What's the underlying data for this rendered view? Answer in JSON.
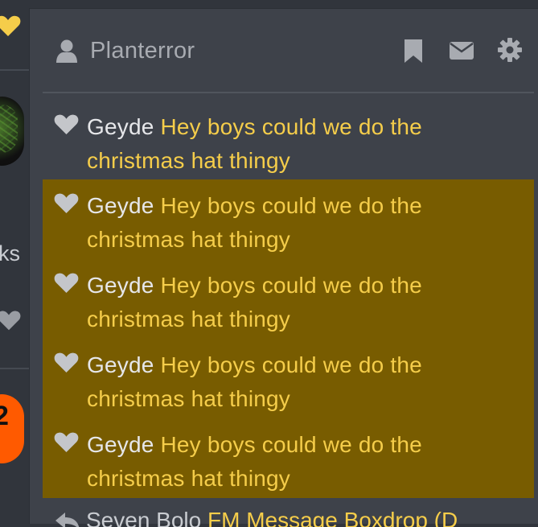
{
  "colors": {
    "accent_yellow": "#f5cd4a",
    "highlight_bg": "#785c00",
    "panel_bg": "#3e424a",
    "page_bg": "#31353c",
    "icon_gray": "#a8abb1",
    "left_heart": "#f5cd4a",
    "orange_avatar": "#ff5a00"
  },
  "left_strip": {
    "partial_text": "ks",
    "heart_icon": "heart-icon",
    "avatar_glyph": "2"
  },
  "header": {
    "username": "Planterror",
    "user_icon": "user-icon",
    "bookmark_icon": "bookmark-icon",
    "mail_icon": "mail-icon",
    "settings_icon": "gear-icon"
  },
  "messages": [
    {
      "author": "Geyde",
      "text": "Hey boys could we do the christmas hat thingy",
      "highlighted": false
    },
    {
      "author": "Geyde",
      "text": "Hey boys could we do the christmas hat thingy",
      "highlighted": true
    },
    {
      "author": "Geyde",
      "text": "Hey boys could we do the christmas hat thingy",
      "highlighted": true
    },
    {
      "author": "Geyde",
      "text": "Hey boys could we do the christmas hat thingy",
      "highlighted": true
    },
    {
      "author": "Geyde",
      "text": "Hey boys could we do the christmas hat thingy",
      "highlighted": true
    }
  ],
  "partial_row": {
    "author": "Seven Bolo",
    "text": "FM Message Boxdrop (D"
  }
}
